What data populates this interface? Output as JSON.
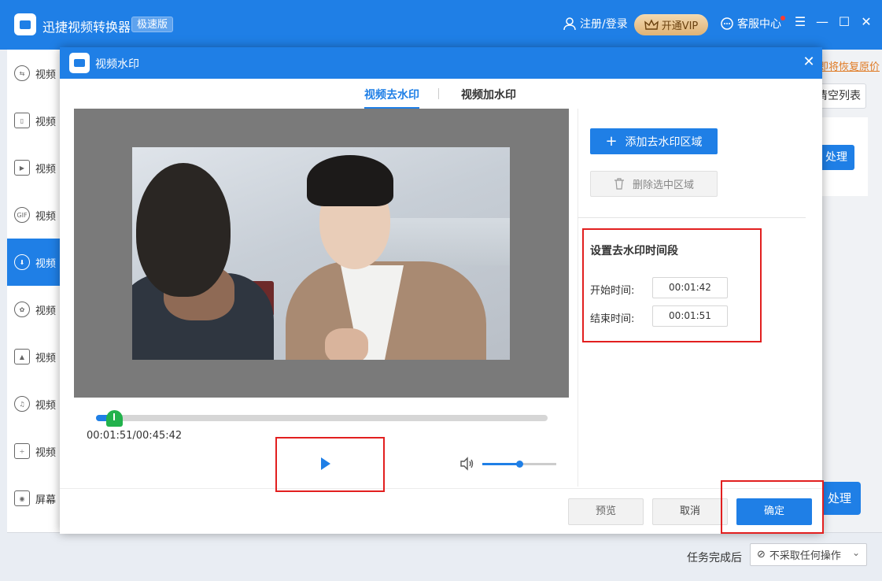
{
  "app": {
    "title": "迅捷视频转换器",
    "edition": "极速版",
    "login_label": "注册/登录",
    "vip_label": "开通VIP",
    "service_label": "客服中心",
    "menu_icon": "hamburger-icon",
    "min_icon": "minimize-icon",
    "max_icon": "maximize-icon",
    "close_icon": "close-icon"
  },
  "sidebar": {
    "items": [
      {
        "label": "视频",
        "icon": "convert-icon"
      },
      {
        "label": "视频",
        "icon": "split-icon"
      },
      {
        "label": "视频",
        "icon": "play-square-icon"
      },
      {
        "label": "视频",
        "icon": "gif-icon"
      },
      {
        "label": "视频",
        "icon": "watermark-icon"
      },
      {
        "label": "视频",
        "icon": "film-reel-icon"
      },
      {
        "label": "视频",
        "icon": "image-icon"
      },
      {
        "label": "视频",
        "icon": "music-icon"
      },
      {
        "label": "视频",
        "icon": "compress-icon"
      },
      {
        "label": "屏幕",
        "icon": "screen-record-icon"
      }
    ],
    "active_index": 4
  },
  "background": {
    "restore_link": "即将恢复原价",
    "clear_list": "清空列表",
    "process_label": "处理",
    "process_all_label": "处理"
  },
  "footer": {
    "after_task_label": "任务完成后",
    "after_task_value": "不采取任何操作"
  },
  "modal": {
    "title": "视频水印",
    "tabs": [
      {
        "label": "视频去水印",
        "active": true
      },
      {
        "label": "视频加水印",
        "active": false
      }
    ],
    "player": {
      "time_readout": "00:01:51/00:45:42",
      "progress_fraction": 0.04,
      "volume_fraction": 0.5
    },
    "panel": {
      "add_area": "添加去水印区域",
      "delete_area": "删除选中区域",
      "time_section_title": "设置去水印时间段",
      "start_label": "开始时间:",
      "start_value": "00:01:42",
      "end_label": "结束时间:",
      "end_value": "00:01:51"
    },
    "buttons": {
      "preview": "预览",
      "cancel": "取消",
      "ok": "确定"
    }
  },
  "colors": {
    "primary": "#1f7fe6",
    "highlight": "#e21f1f",
    "vip_gold": "#dfb376",
    "seek_thumb": "#22b24c"
  }
}
